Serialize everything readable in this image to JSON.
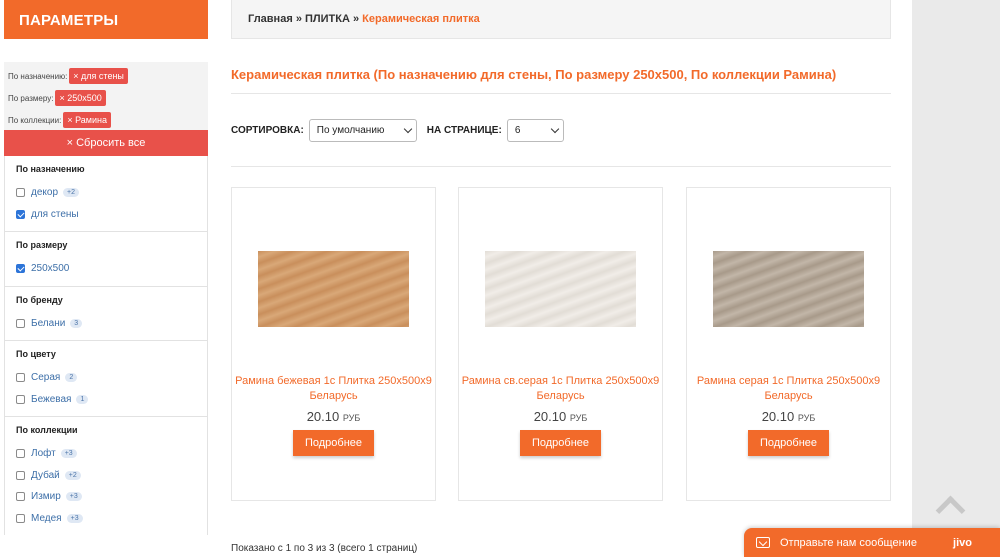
{
  "sidebar": {
    "title": "ПАРАМЕТРЫ",
    "active_filters": [
      {
        "label": "По назначению:",
        "value": "× для стены"
      },
      {
        "label": "По размеру:",
        "value": "× 250x500"
      },
      {
        "label": "По коллекции:",
        "value": "× Рамина"
      }
    ],
    "reset_label": "× Сбросить все",
    "groups": [
      {
        "title": "По назначению",
        "items": [
          {
            "label": "декор",
            "count": "+2",
            "checked": false
          },
          {
            "label": "для стены",
            "count": "",
            "checked": true
          }
        ]
      },
      {
        "title": "По размеру",
        "items": [
          {
            "label": "250x500",
            "count": "",
            "checked": true
          }
        ]
      },
      {
        "title": "По бренду",
        "items": [
          {
            "label": "Белани",
            "count": "3",
            "checked": false
          }
        ]
      },
      {
        "title": "По цвету",
        "items": [
          {
            "label": "Серая",
            "count": "2",
            "checked": false
          },
          {
            "label": "Бежевая",
            "count": "1",
            "checked": false
          }
        ]
      },
      {
        "title": "По коллекции",
        "items": [
          {
            "label": "Лофт",
            "count": "+3",
            "checked": false
          },
          {
            "label": "Дубай",
            "count": "+2",
            "checked": false
          },
          {
            "label": "Измир",
            "count": "+3",
            "checked": false
          },
          {
            "label": "Медея",
            "count": "+3",
            "checked": false
          }
        ]
      }
    ]
  },
  "breadcrumb": {
    "home": "Главная",
    "sep": "»",
    "section": "ПЛИТКА",
    "current": "Керамическая плитка"
  },
  "page_title": "Керамическая плитка (По назначению для стены, По размеру 250x500, По коллекции Рамина)",
  "sort": {
    "label": "СОРТИРОВКА:",
    "value": "По умолчанию",
    "per_page_label": "НА СТРАНИЦЕ:",
    "per_page_value": "6"
  },
  "products": [
    {
      "name": "Рамина бежевая 1с Плитка 250x500x9 Беларусь",
      "price": "20.10",
      "currency": "РУБ",
      "button": "Подробнее",
      "color_a": "#c98f5c",
      "color_b": "#d9a878"
    },
    {
      "name": "Рамина св.серая 1с Плитка 250x500x9 Беларусь",
      "price": "20.10",
      "currency": "РУБ",
      "button": "Подробнее",
      "color_a": "#e2ddd6",
      "color_b": "#f1ede8"
    },
    {
      "name": "Рамина серая 1с Плитка 250x500x9 Беларусь",
      "price": "20.10",
      "currency": "РУБ",
      "button": "Подробнее",
      "color_a": "#a89a8a",
      "color_b": "#c2b6a8"
    }
  ],
  "pagination_text": "Показано с 1 по 3 из 3 (всего 1 страниц)",
  "chat": {
    "label": "Отправьте нам сообщение",
    "brand": "jivo"
  }
}
